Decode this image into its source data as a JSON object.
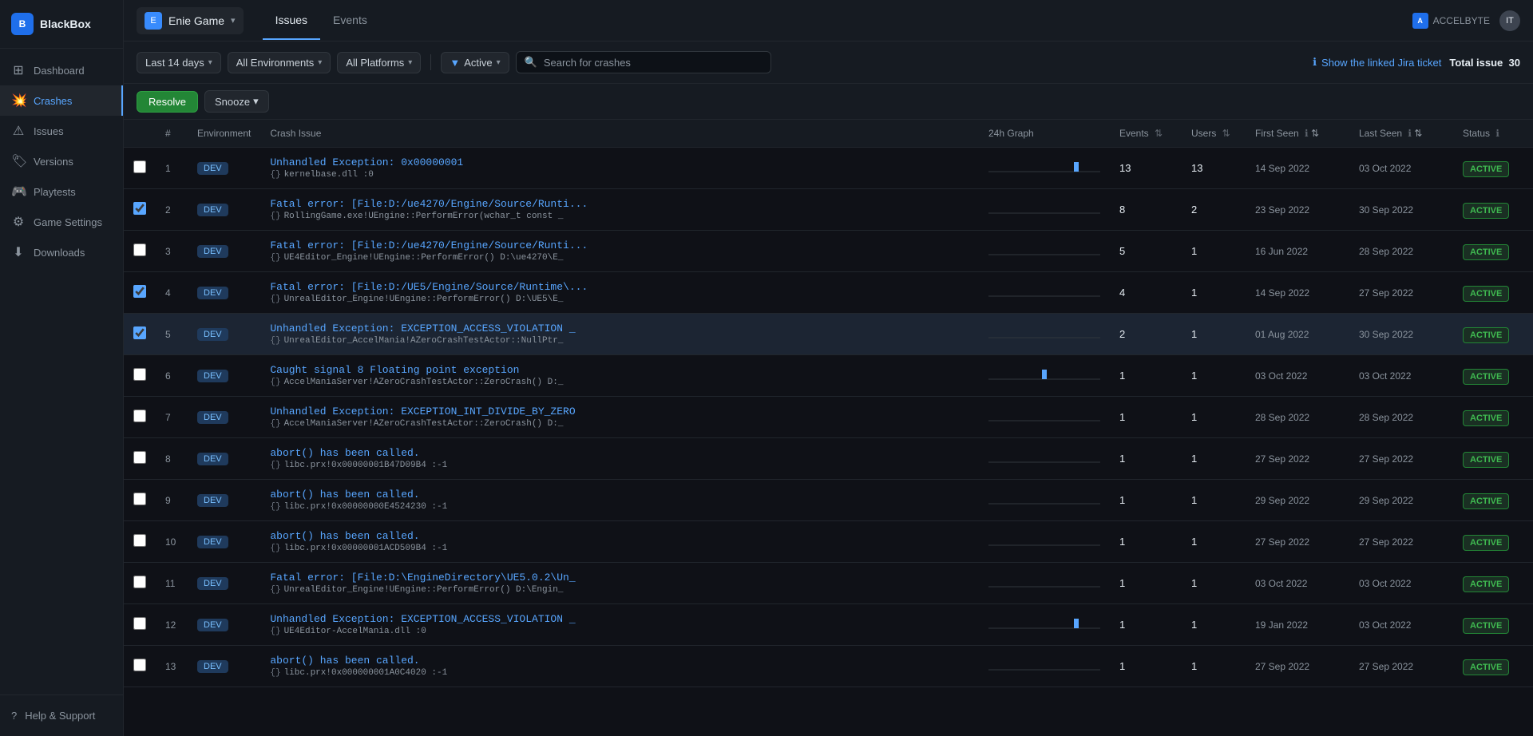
{
  "sidebar": {
    "logo": {
      "text": "BlackBox"
    },
    "items": [
      {
        "id": "dashboard",
        "label": "Dashboard",
        "icon": "⊞"
      },
      {
        "id": "crashes",
        "label": "Crashes",
        "icon": "💥"
      },
      {
        "id": "issues",
        "label": "Issues",
        "icon": "⚠"
      },
      {
        "id": "versions",
        "label": "Versions",
        "icon": "🏷"
      },
      {
        "id": "playtests",
        "label": "Playtests",
        "icon": "🎮"
      },
      {
        "id": "game-settings",
        "label": "Game Settings",
        "icon": "⚙"
      },
      {
        "id": "downloads",
        "label": "Downloads",
        "icon": "⬇"
      }
    ],
    "footer": {
      "label": "Help & Support",
      "icon": "?"
    }
  },
  "topbar": {
    "project": {
      "name": "Enie Game",
      "icon": "E"
    },
    "tabs": [
      {
        "id": "issues",
        "label": "Issues"
      },
      {
        "id": "events",
        "label": "Events"
      }
    ],
    "brand": {
      "name": "ACCELBYTE"
    },
    "user": {
      "initials": "IT"
    }
  },
  "filters": {
    "date": "Last 14 days",
    "environment": "All Environments",
    "platform": "All Platforms",
    "status": "Active",
    "search_placeholder": "Search for crashes",
    "jira_label": "Show the linked Jira ticket",
    "total_issue_label": "Total issue",
    "total_issue_count": "30"
  },
  "actions": {
    "resolve": "Resolve",
    "snooze": "Snooze"
  },
  "table": {
    "columns": [
      {
        "id": "num",
        "label": "#"
      },
      {
        "id": "env",
        "label": "Environment"
      },
      {
        "id": "crash",
        "label": "Crash Issue"
      },
      {
        "id": "graph",
        "label": "24h Graph"
      },
      {
        "id": "events",
        "label": "Events"
      },
      {
        "id": "users",
        "label": "Users"
      },
      {
        "id": "firstseen",
        "label": "First Seen"
      },
      {
        "id": "lastseen",
        "label": "Last Seen"
      },
      {
        "id": "status",
        "label": "Status"
      }
    ],
    "rows": [
      {
        "num": "1",
        "env": "DEV",
        "checked": false,
        "crash_title": "Unhandled Exception: 0x00000001",
        "crash_sub": "kernelbase.dll :0",
        "events": "13",
        "users": "13",
        "first_seen": "14 Sep 2022",
        "last_seen": "03 Oct 2022",
        "status": "ACTIVE",
        "has_spike": true,
        "spike_pos": "right"
      },
      {
        "num": "2",
        "env": "DEV",
        "checked": true,
        "crash_title": "Fatal error: [File:D:/ue4270/Engine/Source/Runti...",
        "crash_sub": "RollingGame.exe!UEngine::PerformError(wchar_t const _",
        "events": "8",
        "users": "2",
        "first_seen": "23 Sep 2022",
        "last_seen": "30 Sep 2022",
        "status": "ACTIVE",
        "has_spike": false
      },
      {
        "num": "3",
        "env": "DEV",
        "checked": false,
        "crash_title": "Fatal error: [File:D:/ue4270/Engine/Source/Runti...",
        "crash_sub": "UE4Editor_Engine!UEngine::PerformError() D:\\ue4270\\E_",
        "events": "5",
        "users": "1",
        "first_seen": "16 Jun 2022",
        "last_seen": "28 Sep 2022",
        "status": "ACTIVE",
        "has_spike": false
      },
      {
        "num": "4",
        "env": "DEV",
        "checked": true,
        "crash_title": "Fatal error: [File:D:/UE5/Engine/Source/Runtime\\...",
        "crash_sub": "UnrealEditor_Engine!UEngine::PerformError() D:\\UE5\\E_",
        "events": "4",
        "users": "1",
        "first_seen": "14 Sep 2022",
        "last_seen": "27 Sep 2022",
        "status": "ACTIVE",
        "has_spike": false
      },
      {
        "num": "5",
        "env": "DEV",
        "checked": true,
        "crash_title": "Unhandled Exception: EXCEPTION_ACCESS_VIOLATION _",
        "crash_sub": "UnrealEditor_AccelMania!AZeroCrashTestActor::NullPtr_",
        "events": "2",
        "users": "1",
        "first_seen": "01 Aug 2022",
        "last_seen": "30 Sep 2022",
        "status": "ACTIVE",
        "has_spike": false,
        "selected": true
      },
      {
        "num": "6",
        "env": "DEV",
        "checked": false,
        "crash_title": "Caught signal 8 Floating point exception",
        "crash_sub": "AccelManiaServer!AZeroCrashTestActor::ZeroCrash() D:_",
        "events": "1",
        "users": "1",
        "first_seen": "03 Oct 2022",
        "last_seen": "03 Oct 2022",
        "status": "ACTIVE",
        "has_spike": true,
        "spike_pos": "middle"
      },
      {
        "num": "7",
        "env": "DEV",
        "checked": false,
        "crash_title": "Unhandled Exception: EXCEPTION_INT_DIVIDE_BY_ZERO",
        "crash_sub": "AccelManiaServer!AZeroCrashTestActor::ZeroCrash() D:_",
        "events": "1",
        "users": "1",
        "first_seen": "28 Sep 2022",
        "last_seen": "28 Sep 2022",
        "status": "ACTIVE",
        "has_spike": false
      },
      {
        "num": "8",
        "env": "DEV",
        "checked": false,
        "crash_title": "abort() has been called.",
        "crash_sub": "libc.prx!0x00000001B47D09B4 :-1",
        "events": "1",
        "users": "1",
        "first_seen": "27 Sep 2022",
        "last_seen": "27 Sep 2022",
        "status": "ACTIVE",
        "has_spike": false
      },
      {
        "num": "9",
        "env": "DEV",
        "checked": false,
        "crash_title": "abort() has been called.",
        "crash_sub": "libc.prx!0x00000000E4524230 :-1",
        "events": "1",
        "users": "1",
        "first_seen": "29 Sep 2022",
        "last_seen": "29 Sep 2022",
        "status": "ACTIVE",
        "has_spike": false
      },
      {
        "num": "10",
        "env": "DEV",
        "checked": false,
        "crash_title": "abort() has been called.",
        "crash_sub": "libc.prx!0x00000001ACD509B4 :-1",
        "events": "1",
        "users": "1",
        "first_seen": "27 Sep 2022",
        "last_seen": "27 Sep 2022",
        "status": "ACTIVE",
        "has_spike": false
      },
      {
        "num": "11",
        "env": "DEV",
        "checked": false,
        "crash_title": "Fatal error: [File:D:\\EngineDirectory\\UE5.0.2\\Un_",
        "crash_sub": "UnrealEditor_Engine!UEngine::PerformError() D:\\Engin_",
        "events": "1",
        "users": "1",
        "first_seen": "03 Oct 2022",
        "last_seen": "03 Oct 2022",
        "status": "ACTIVE",
        "has_spike": false
      },
      {
        "num": "12",
        "env": "DEV",
        "checked": false,
        "crash_title": "Unhandled Exception: EXCEPTION_ACCESS_VIOLATION _",
        "crash_sub": "UE4Editor-AccelMania.dll :0",
        "events": "1",
        "users": "1",
        "first_seen": "19 Jan 2022",
        "last_seen": "03 Oct 2022",
        "status": "ACTIVE",
        "has_spike": true,
        "spike_pos": "right"
      },
      {
        "num": "13",
        "env": "DEV",
        "checked": false,
        "crash_title": "abort() has been called.",
        "crash_sub": "libc.prx!0x000000001A0C4020 :-1",
        "events": "1",
        "users": "1",
        "first_seen": "27 Sep 2022",
        "last_seen": "27 Sep 2022",
        "status": "ACTIVE",
        "has_spike": false
      }
    ]
  }
}
